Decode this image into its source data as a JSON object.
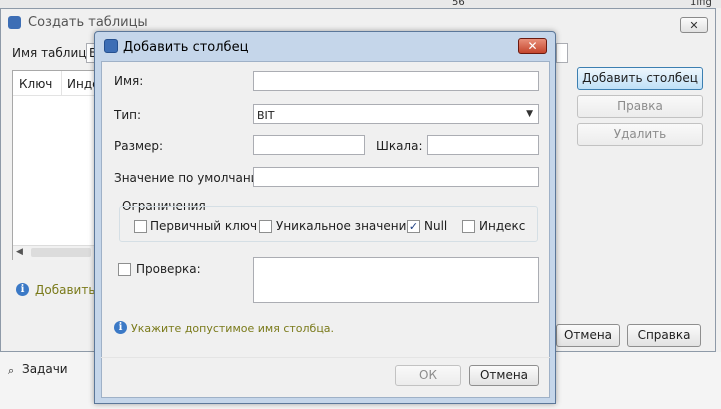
{
  "background": {
    "ide_cell_value": "56",
    "ide_cell_right": "1ifig",
    "tasks_label": "Задачи"
  },
  "outer_window": {
    "title": "Создать таблицы",
    "close_label": "✕",
    "table_name_label": "Имя таблицы:",
    "table_name_value": "B",
    "columns": [
      "Ключ",
      "Инде"
    ],
    "add_column_button": "Добавить столбец",
    "edit_button": "Правка",
    "delete_button": "Удалить",
    "hint_text": "Добавить с",
    "cancel_button": "Отмена",
    "help_button": "Справка"
  },
  "dialog": {
    "title": "Добавить столбец",
    "close_label": "✕",
    "name_label": "Имя:",
    "name_value": "",
    "type_label": "Тип:",
    "type_value": "BIT",
    "size_label": "Размер:",
    "size_value": "",
    "scale_label": "Шкала:",
    "scale_value": "",
    "default_label": "Значение по умолчанию:",
    "default_value": "",
    "constraints_label": "Ограничения",
    "constraints": [
      {
        "label": "Первичный ключ",
        "checked": false
      },
      {
        "label": "Уникальное значение",
        "checked": false
      },
      {
        "label": "Null",
        "checked": true
      },
      {
        "label": "Индекс",
        "checked": false
      }
    ],
    "check_label": "Проверка:",
    "check_checked": false,
    "check_value": "",
    "info_text": "Укажите допустимое имя столбца.",
    "ok_button": "ОК",
    "cancel_button": "Отмена"
  },
  "colors": {
    "dialog_frame": "#c5d6ea",
    "close_button": "#c4452d",
    "info_icon": "#3b79c6",
    "info_text": "#7a7a1a"
  }
}
